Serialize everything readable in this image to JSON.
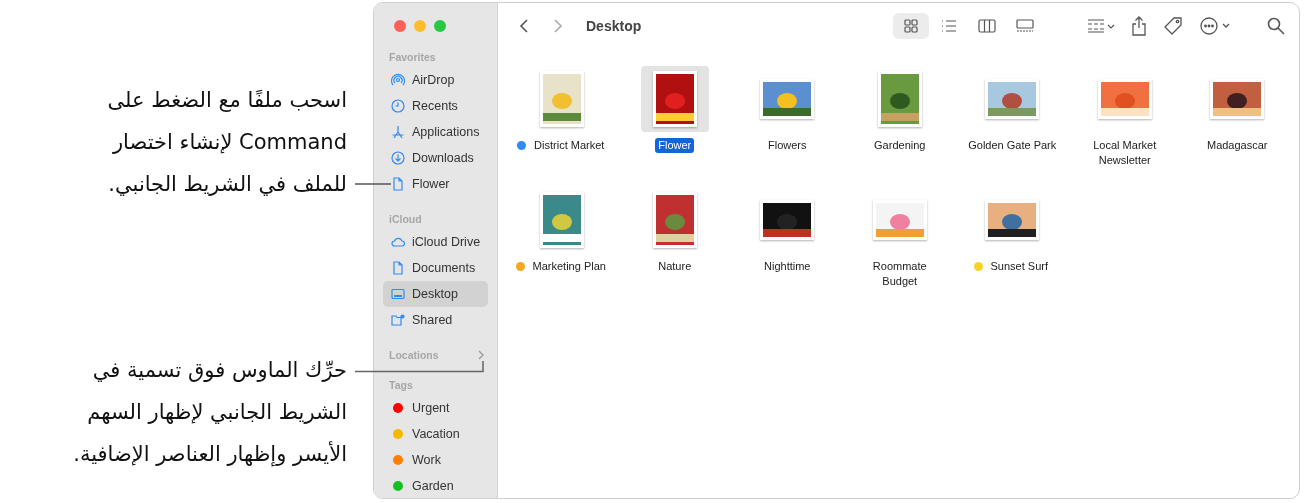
{
  "callouts": [
    {
      "lines": [
        "اسحب ملفًا مع الضغط على",
        "Command لإنشاء اختصار",
        "للملف في الشريط الجانبي."
      ]
    },
    {
      "lines": [
        "حرِّك الماوس فوق تسمية في",
        "الشريط الجانبي لإظهار السهم",
        "الأيسر وإظهار العناصر الإضافية."
      ]
    }
  ],
  "window": {
    "title": "Desktop",
    "sidebar": [
      {
        "heading": "Favorites",
        "items": [
          {
            "label": "AirDrop",
            "kind": "airdrop",
            "selected": false
          },
          {
            "label": "Recents",
            "kind": "clock",
            "selected": false
          },
          {
            "label": "Applications",
            "kind": "apps",
            "selected": false
          },
          {
            "label": "Downloads",
            "kind": "download",
            "selected": false
          },
          {
            "label": "Flower",
            "kind": "doc",
            "selected": false
          }
        ]
      },
      {
        "heading": "iCloud",
        "items": [
          {
            "label": "iCloud Drive",
            "kind": "cloud",
            "selected": false
          },
          {
            "label": "Documents",
            "kind": "doc",
            "selected": false
          },
          {
            "label": "Desktop",
            "kind": "desktop",
            "selected": true
          },
          {
            "label": "Shared",
            "kind": "shared",
            "selected": false
          }
        ]
      },
      {
        "heading": "Locations",
        "chevron": true
      },
      {
        "heading": "Tags",
        "items": [
          {
            "label": "Urgent",
            "kind": "tag",
            "color": "#ff0000",
            "selected": false
          },
          {
            "label": "Vacation",
            "kind": "tag",
            "color": "#f5b800",
            "selected": false
          },
          {
            "label": "Work",
            "kind": "tag",
            "color": "#ff7f00",
            "selected": false
          },
          {
            "label": "Garden",
            "kind": "tag",
            "color": "#14c21f",
            "selected": false
          }
        ]
      }
    ],
    "views": [
      {
        "kind": "icons",
        "selected": true
      },
      {
        "kind": "list",
        "selected": false
      },
      {
        "kind": "columns",
        "selected": false
      },
      {
        "kind": "gallery",
        "selected": false
      }
    ],
    "files": [
      {
        "name": "District Market",
        "kind": "portrait",
        "color": "#2f8af5",
        "selected": false
      },
      {
        "name": "Flower",
        "kind": "portrait",
        "selected": true
      },
      {
        "name": "Flowers",
        "kind": "landscape",
        "selected": false
      },
      {
        "name": "Gardening",
        "kind": "portrait",
        "selected": false
      },
      {
        "name": "Golden Gate Park",
        "kind": "landscape",
        "selected": false
      },
      {
        "name": "Local Market Newsletter",
        "kind": "landscape",
        "selected": false
      },
      {
        "name": "Madagascar",
        "kind": "landscape",
        "selected": false
      },
      {
        "name": "Marketing Plan",
        "kind": "portrait",
        "color": "#f5a623",
        "selected": false
      },
      {
        "name": "Nature",
        "kind": "portrait",
        "selected": false
      },
      {
        "name": "Nighttime",
        "kind": "landscape",
        "selected": false
      },
      {
        "name": "Roommate Budget",
        "kind": "landscape",
        "selected": false
      },
      {
        "name": "Sunset Surf",
        "kind": "landscape",
        "color": "#f7d32a",
        "selected": false
      }
    ]
  }
}
